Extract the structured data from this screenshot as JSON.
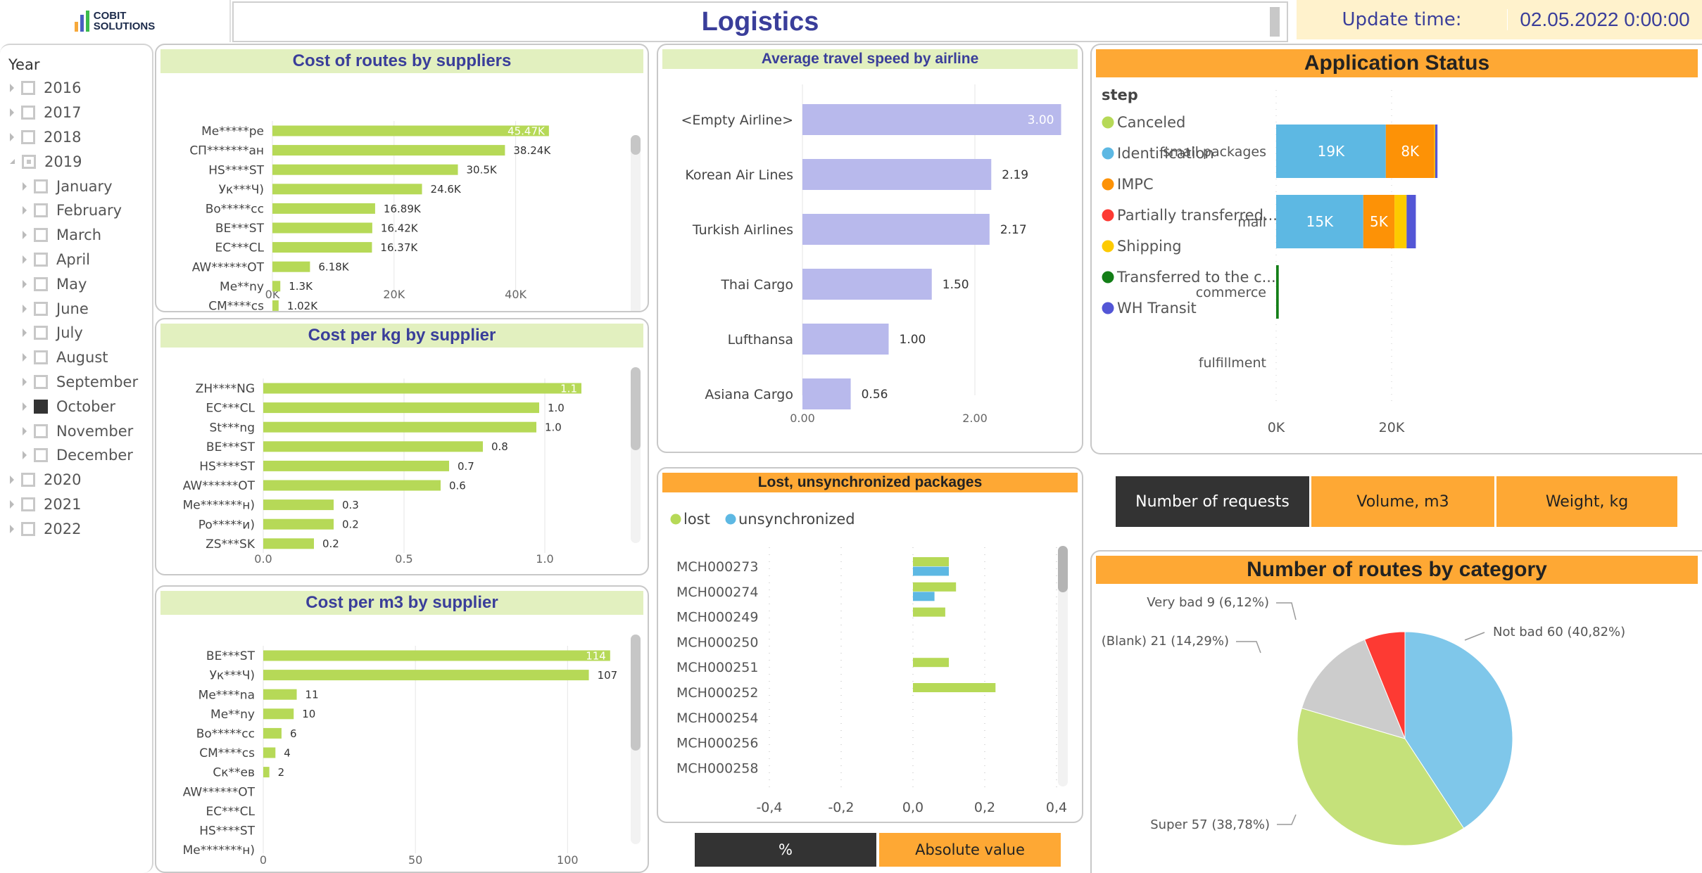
{
  "header": {
    "logo_line1": "COBIT",
    "logo_line2": "SOLUTIONS",
    "logo_bar_colors": [
      "#f6a93b",
      "#4a5fc1",
      "#3cbb4c"
    ],
    "title": "Logistics",
    "update_label": "Update time:",
    "update_value": "02.05.2022 0:00:00"
  },
  "slicer": {
    "title": "Year",
    "items": [
      {
        "label": "2016",
        "level": 0,
        "state": "unchecked",
        "expanded": false
      },
      {
        "label": "2017",
        "level": 0,
        "state": "unchecked",
        "expanded": false
      },
      {
        "label": "2018",
        "level": 0,
        "state": "unchecked",
        "expanded": false
      },
      {
        "label": "2019",
        "level": 0,
        "state": "partial",
        "expanded": true
      },
      {
        "label": "January",
        "level": 1,
        "state": "unchecked",
        "expanded": false
      },
      {
        "label": "February",
        "level": 1,
        "state": "unchecked",
        "expanded": false
      },
      {
        "label": "March",
        "level": 1,
        "state": "unchecked",
        "expanded": false
      },
      {
        "label": "April",
        "level": 1,
        "state": "unchecked",
        "expanded": false
      },
      {
        "label": "May",
        "level": 1,
        "state": "unchecked",
        "expanded": false
      },
      {
        "label": "June",
        "level": 1,
        "state": "unchecked",
        "expanded": false
      },
      {
        "label": "July",
        "level": 1,
        "state": "unchecked",
        "expanded": false
      },
      {
        "label": "August",
        "level": 1,
        "state": "unchecked",
        "expanded": false
      },
      {
        "label": "September",
        "level": 1,
        "state": "unchecked",
        "expanded": false
      },
      {
        "label": "October",
        "level": 1,
        "state": "checked",
        "expanded": false
      },
      {
        "label": "November",
        "level": 1,
        "state": "unchecked",
        "expanded": false
      },
      {
        "label": "December",
        "level": 1,
        "state": "unchecked",
        "expanded": false
      },
      {
        "label": "2020",
        "level": 0,
        "state": "unchecked",
        "expanded": false
      },
      {
        "label": "2021",
        "level": 0,
        "state": "unchecked",
        "expanded": false
      },
      {
        "label": "2022",
        "level": 0,
        "state": "unchecked",
        "expanded": false
      }
    ]
  },
  "lost_toggle": {
    "percent_label": "%",
    "absolute_label": "Absolute value",
    "active": "percent"
  },
  "metric_toggle": {
    "buttons": [
      "Number of requests",
      "Volume, m3",
      "Weight, kg"
    ],
    "active": 0
  },
  "colors": {
    "bar_green": "#b6d957",
    "bar_lavender": "#b8b9ec",
    "title_green_bg": "#e2f0bf",
    "title_orange_bg": "#fea834",
    "title_blue": "#3a3e9a"
  },
  "chart_data": [
    {
      "id": "cost_routes",
      "type": "bar",
      "orientation": "horizontal",
      "title": "Cost of routes by suppliers",
      "categories": [
        "Me*****pe",
        "СП*******ан",
        "HS****ST",
        "Ук***Ч)",
        "Bo*****cc",
        "BE***ST",
        "EC***CL",
        "AW******OT",
        "Me**ny",
        "CM****cs"
      ],
      "values": [
        45470,
        38240,
        30500,
        24600,
        16890,
        16420,
        16370,
        6180,
        1300,
        1020
      ],
      "labels": [
        "45.47K",
        "38.24K",
        "30.5K",
        "24.6K",
        "16.89K",
        "16.42K",
        "16.37K",
        "6.18K",
        "1.3K",
        "1.02K"
      ],
      "xticks": [
        0,
        20000,
        40000
      ],
      "xtick_labels": [
        "0K",
        "20K",
        "40K"
      ],
      "xlim": [
        0,
        50000
      ],
      "grid": true
    },
    {
      "id": "cost_kg",
      "type": "bar",
      "orientation": "horizontal",
      "title": "Cost per kg by supplier",
      "categories": [
        "ZH****NG",
        "EC***CL",
        "St***ng",
        "BE***ST",
        "HS****ST",
        "AW******OT",
        "Me*******н)",
        "Po*****и)",
        "ZS***SK"
      ],
      "values": [
        1.13,
        0.98,
        0.97,
        0.78,
        0.66,
        0.63,
        0.25,
        0.25,
        0.18
      ],
      "labels": [
        "1.1",
        "1.0",
        "1.0",
        "0.8",
        "0.7",
        "0.6",
        "0.3",
        "0.2",
        "0.2"
      ],
      "xticks": [
        0,
        0.5,
        1.0
      ],
      "xtick_labels": [
        "0.0",
        "0.5",
        "1.0"
      ],
      "xlim": [
        0,
        1.2
      ],
      "grid": true
    },
    {
      "id": "cost_m3",
      "type": "bar",
      "orientation": "horizontal",
      "title": "Cost per m3 by supplier",
      "categories": [
        "BE***ST",
        "Ук***Ч)",
        "Me****na",
        "Me**ny",
        "Bo*****cc",
        "CM****cs",
        "Ск**ев",
        "AW******OT",
        "EC***CL",
        "HS****ST",
        "Me*******н)"
      ],
      "values": [
        114,
        107,
        11,
        10,
        6,
        4,
        2,
        null,
        null,
        null,
        null
      ],
      "labels": [
        "114",
        "107",
        "11",
        "10",
        "6",
        "4",
        "2",
        "",
        "",
        "",
        ""
      ],
      "xticks": [
        0,
        50,
        100
      ],
      "xtick_labels": [
        "0",
        "50",
        "100"
      ],
      "xlim": [
        0,
        130
      ],
      "grid": true
    },
    {
      "id": "airline_speed",
      "type": "bar",
      "orientation": "horizontal",
      "title": "Average travel speed by airline",
      "categories": [
        "<Empty Airline>",
        "Korean Air Lines",
        "Turkish Airlines",
        "Thai Cargo",
        "Lufthansa",
        "Asiana Cargo"
      ],
      "values": [
        3.0,
        2.19,
        2.17,
        1.5,
        1.0,
        0.56
      ],
      "labels": [
        "3.00",
        "2.19",
        "2.17",
        "1.50",
        "1.00",
        "0.56"
      ],
      "xticks": [
        0,
        2
      ],
      "xtick_labels": [
        "0.00",
        "2.00"
      ],
      "xlim": [
        0,
        3.2
      ],
      "grid": true
    },
    {
      "id": "lost_unsync",
      "type": "bar",
      "orientation": "horizontal",
      "title": "Lost, unsynchronized packages",
      "categories": [
        "MCH000273",
        "MCH000274",
        "MCH000249",
        "MCH000250",
        "MCH000251",
        "MCH000252",
        "MCH000254",
        "MCH000256",
        "MCH000258"
      ],
      "series": [
        {
          "name": "lost",
          "color": "#b6d957",
          "values": [
            0.1,
            0.12,
            0.09,
            null,
            0.1,
            0.23,
            null,
            null,
            null
          ]
        },
        {
          "name": "unsynchronized",
          "color": "#5db8e3",
          "values": [
            0.1,
            0.06,
            null,
            null,
            null,
            null,
            null,
            null,
            null
          ]
        }
      ],
      "xticks": [
        -0.4,
        -0.2,
        0.0,
        0.2,
        0.4
      ],
      "xtick_labels": [
        "-0,4",
        "-0,2",
        "0,0",
        "0,2",
        "0,4"
      ],
      "xlim": [
        -0.5,
        0.42
      ],
      "legend": "top-left",
      "grid": true
    },
    {
      "id": "app_status",
      "type": "bar",
      "orientation": "horizontal",
      "stacked": true,
      "title": "Application Status",
      "legend_title": "step",
      "legend": "left",
      "categories": [
        "small packages",
        "mail",
        "commerce",
        "fulfillment"
      ],
      "series": [
        {
          "name": "Canceled",
          "color": "#b6d957",
          "values": [
            0,
            0,
            0,
            0
          ]
        },
        {
          "name": "Identification",
          "color": "#5db8e3",
          "values": [
            19000,
            15100,
            0,
            0
          ]
        },
        {
          "name": "IMPC",
          "color": "#fd9206",
          "values": [
            8400,
            5400,
            0,
            0
          ]
        },
        {
          "name": "Partially transferred...",
          "color": "#fd3a33",
          "values": [
            0,
            0,
            0,
            0
          ]
        },
        {
          "name": "Shipping",
          "color": "#fdca00",
          "values": [
            150,
            2100,
            0,
            0
          ]
        },
        {
          "name": "Transferred to the c...",
          "color": "#137e17",
          "values": [
            0,
            0,
            450,
            0
          ]
        },
        {
          "name": "WH Transit",
          "color": "#5356d6",
          "values": [
            400,
            1600,
            0,
            0
          ]
        }
      ],
      "segment_labels": [
        [
          "",
          "19K",
          "8K",
          "",
          "",
          "",
          ""
        ],
        [
          "",
          "15K",
          "5K",
          "",
          "",
          "",
          ""
        ],
        [
          "",
          "",
          "",
          "",
          "",
          "",
          ""
        ],
        [
          "",
          "",
          "",
          "",
          "",
          "",
          ""
        ]
      ],
      "xticks": [
        0,
        20000
      ],
      "xtick_labels": [
        "0K",
        "20K"
      ],
      "xlim": [
        0,
        31000
      ],
      "grid": true
    },
    {
      "id": "routes_category",
      "type": "pie",
      "title": "Number of routes by category",
      "slices": [
        {
          "label": "Not bad",
          "value": 60,
          "percent": "40,82%",
          "color": "#7fc7ea"
        },
        {
          "label": "Super",
          "value": 57,
          "percent": "38,78%",
          "color": "#c5e17a"
        },
        {
          "label": "(Blank)",
          "value": 21,
          "percent": "14,29%",
          "color": "#cccccc"
        },
        {
          "label": "Very bad",
          "value": 9,
          "percent": "6,12%",
          "color": "#fd3a33"
        }
      ],
      "slice_labels": [
        "Not bad 60 (40,82%)",
        "Super 57 (38,78%)",
        "(Blank) 21 (14,29%)",
        "Very bad 9 (6,12%)"
      ]
    }
  ]
}
